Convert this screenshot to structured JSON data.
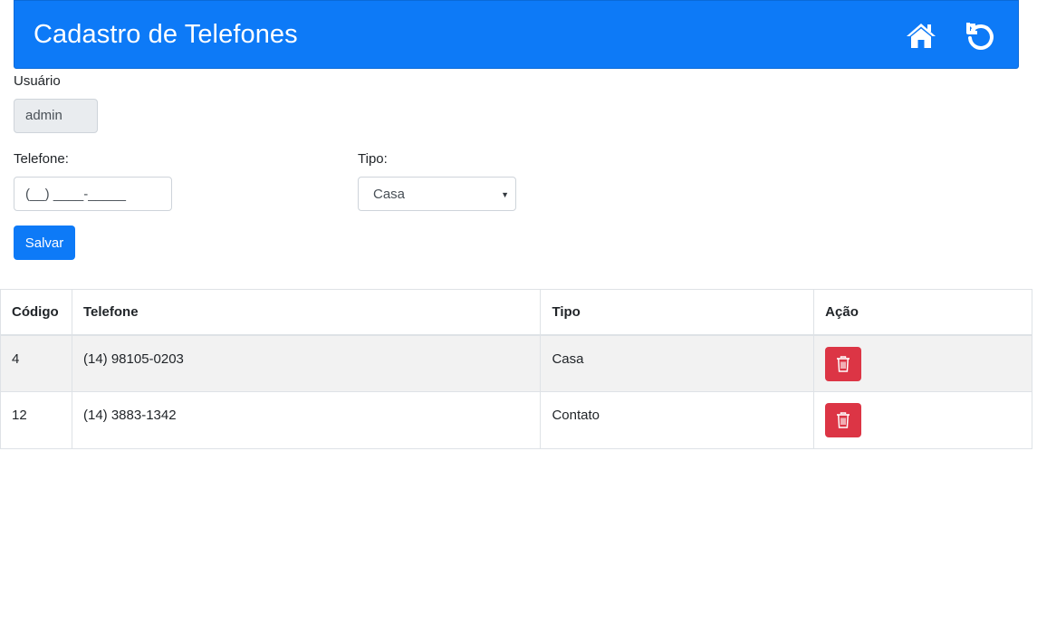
{
  "header": {
    "title": "Cadastro de Telefones",
    "home_icon": "home-icon",
    "reset_icon": "undo-icon"
  },
  "form": {
    "user_label": "Usuário",
    "user_value": "admin",
    "phone_label": "Telefone:",
    "phone_placeholder": "(__) ____-_____",
    "type_label": "Tipo:",
    "type_selected": "Casa",
    "save_label": "Salvar"
  },
  "colors": {
    "primary": "#0d7af7",
    "danger": "#dc3545"
  },
  "table": {
    "headers": [
      "Código",
      "Telefone",
      "Tipo",
      "Ação"
    ],
    "rows": [
      {
        "code": "4",
        "phone": "(14) 98105-0203",
        "type": "Casa",
        "action_icon": "trash-icon"
      },
      {
        "code": "12",
        "phone": "(14) 3883-1342",
        "type": "Contato",
        "action_icon": "trash-icon"
      }
    ]
  }
}
